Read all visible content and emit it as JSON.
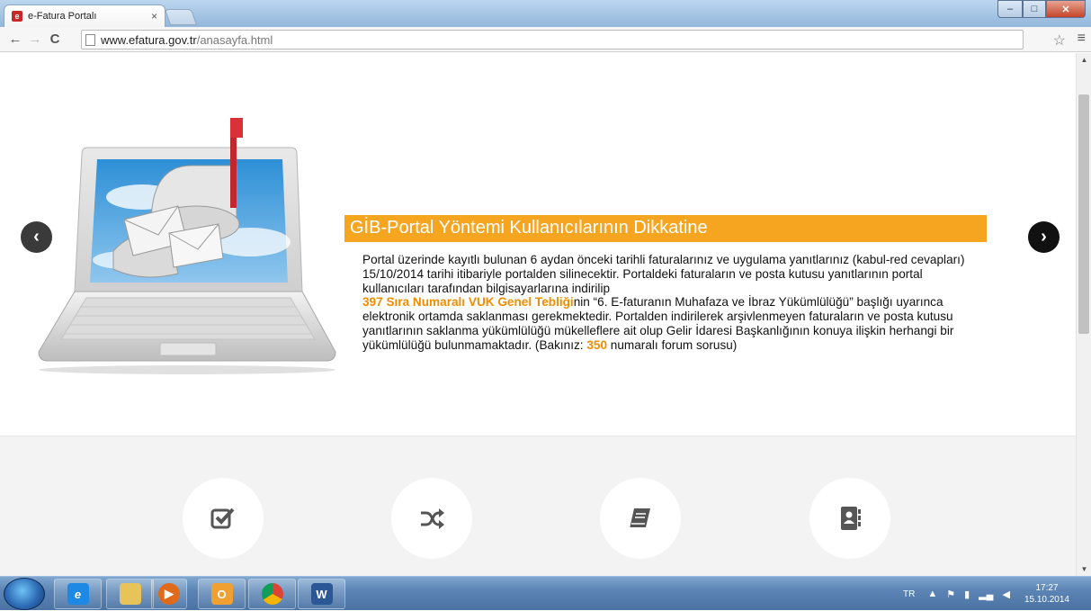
{
  "browser": {
    "tab_title": "e-Fatura Portalı",
    "tab_close": "×",
    "url_host": "www.efatura.gov.tr",
    "url_path": "/anasayfa.html",
    "window_controls": [
      "–",
      "□",
      "✕"
    ]
  },
  "slider": {
    "title": "GİB-Portal Yöntemi Kullanıcılarının Dikkatine",
    "paragraph_part1": "Portal üzerinde kayıtlı bulunan 6 aydan önceki tarihli faturalarınız ve uygulama yanıtlarınız (kabul-red cevapları) 15/10/2014 tarihi itibariyle portalden silinecektir. Portaldeki faturaların ve posta kutusu yanıtlarının portal kullanıcıları tarafından bilgisayarlarına indirilip",
    "link_vuk": "397 Sıra Numaralı VUK Genel Tebliği",
    "paragraph_part2": "nin “6. E-faturanın Muhafaza ve İbraz Yükümlülüğü” başlığı uyarınca elektronik ortamda saklanması gerekmektedir. Portalden indirilerek arşivlenmeyen faturaların ve posta kutusu yanıtlarının saklanma yükümlülüğü mükelleflere ait olup Gelir İdaresi Başkanlığının konuya ilişkin herhangi bir yükümlülüğü bulunmamaktadır. (Bakınız: ",
    "link_forum": "350",
    "paragraph_part3": " numaralı forum sorusu)"
  },
  "features": {
    "icons": [
      "checkbox-icon",
      "shuffle-icon",
      "book-icon",
      "contacts-icon"
    ]
  },
  "taskbar": {
    "language": "TR",
    "time": "17:27",
    "date": "15.10.2014"
  },
  "colors": {
    "accent": "#f6a521",
    "link": "#f28c00"
  }
}
